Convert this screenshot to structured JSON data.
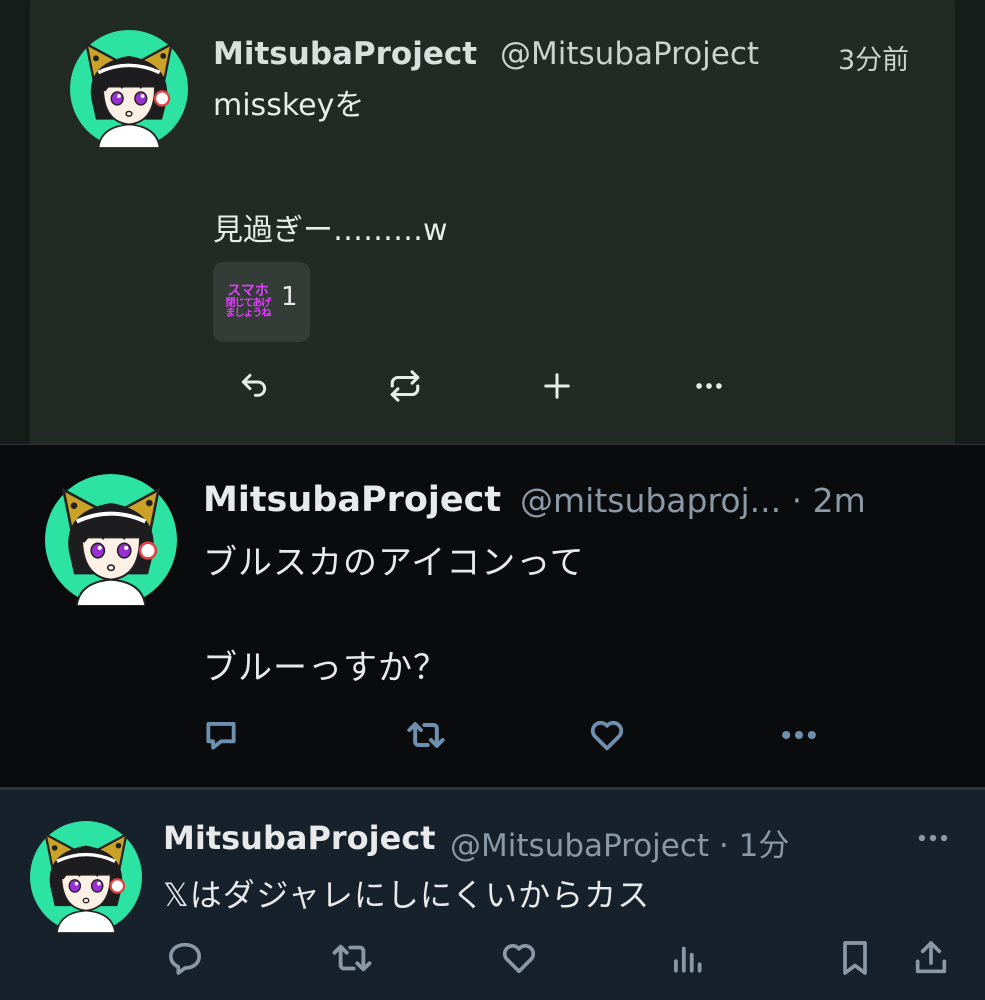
{
  "misskey_note": {
    "display_name": "MitsubaProject",
    "handle": "@MitsubaProject",
    "time": "3分前",
    "text_line1": "misskeyを",
    "text_line2": "見過ぎー………w",
    "reaction": {
      "emoji_line1": "スマホ",
      "emoji_line2": "閉じてあげ",
      "emoji_line3": "ましょうね",
      "count": "1"
    },
    "actions": [
      "reply-icon",
      "renote-icon",
      "plus-icon",
      "more-icon"
    ]
  },
  "x_dark_tweet": {
    "display_name": "MitsubaProject",
    "handle_time": "@mitsubaproj... · 2m",
    "text_line1": "ブルスカのアイコンって",
    "text_line2": "ブルーっすか？",
    "actions": [
      "reply-icon",
      "retweet-icon",
      "like-icon",
      "more-icon"
    ]
  },
  "x_dim_tweet": {
    "display_name": "MitsubaProject",
    "handle_time": "@MitsubaProject · 1分",
    "text": "𝕏はダジャレにしにくいからカス",
    "actions": [
      "reply-icon",
      "retweet-icon",
      "like-icon",
      "views-icon",
      "bookmark-icon",
      "share-icon"
    ]
  },
  "colors": {
    "misskey_bg": "#151c19",
    "misskey_card": "#222a26",
    "x_dark_bg": "#0a0b0c",
    "x_dim_bg": "#17212b",
    "avatar_bg": "#2de3a3",
    "reaction_text": "#e040fb"
  }
}
